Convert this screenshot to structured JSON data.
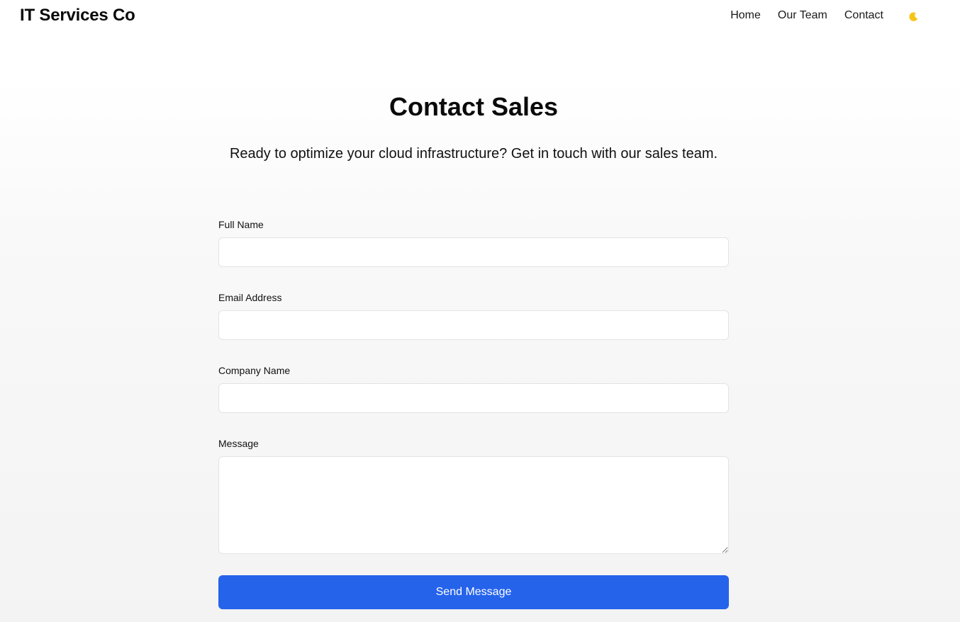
{
  "header": {
    "brand": "IT Services Co",
    "nav": [
      {
        "label": "Home"
      },
      {
        "label": "Our Team"
      },
      {
        "label": "Contact"
      }
    ],
    "theme_toggle": {
      "icon": "moon-icon",
      "color": "#f5c518"
    }
  },
  "main": {
    "title": "Contact Sales",
    "subtitle": "Ready to optimize your cloud infrastructure? Get in touch with our sales team."
  },
  "form": {
    "full_name": {
      "label": "Full Name",
      "value": "",
      "placeholder": ""
    },
    "email": {
      "label": "Email Address",
      "value": "",
      "placeholder": ""
    },
    "company": {
      "label": "Company Name",
      "value": "",
      "placeholder": ""
    },
    "message": {
      "label": "Message",
      "value": "",
      "placeholder": ""
    },
    "submit_label": "Send Message"
  },
  "colors": {
    "accent": "#2563eb",
    "text": "#111111",
    "input_border": "#e3e3e3"
  }
}
